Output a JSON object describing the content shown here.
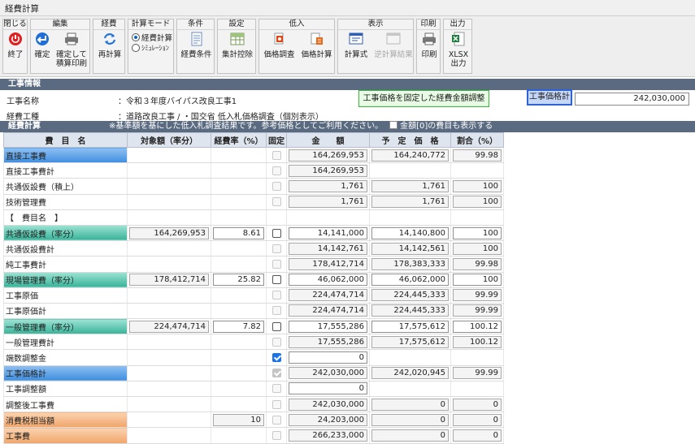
{
  "window": {
    "title": "経費計算"
  },
  "toolbar": {
    "close": {
      "title": "閉じる",
      "end": "終了"
    },
    "edit": {
      "title": "編集",
      "confirm": "確定",
      "confirm_print": "確定して積算印刷"
    },
    "cost": {
      "title": "経費",
      "recalc": "再計算"
    },
    "mode": {
      "title": "計算モード",
      "opt1": "経費計算",
      "opt2": "ｼﾐｭﾚｰｼｮﾝ"
    },
    "cond": {
      "title": "条件",
      "cond_btn": "経費条件"
    },
    "setting": {
      "title": "設定",
      "deduct": "集計控除"
    },
    "lowbid": {
      "title": "低入",
      "survey": "価格調査",
      "calc": "価格計算"
    },
    "display": {
      "title": "表示",
      "formula": "計算式",
      "reverse": "逆計算結果"
    },
    "print": {
      "title": "印刷",
      "print_btn": "印刷"
    },
    "output": {
      "title": "出力",
      "xlsx": "XLSX出力"
    }
  },
  "info": {
    "section": "工事情報",
    "name_label": "工事名称",
    "name_value": "：令和３年度バイパス改良工事1",
    "type_label": "経費工種",
    "type_value": "：道路改良工事 / ・国交省 低入札価格調査（個別表示）",
    "adjust_button": "工事価格を固定した経費金額調整",
    "price_label": "工事価格計",
    "price_value": "242,030,000"
  },
  "calc": {
    "section": "経費計算",
    "note": "※基準額を基にした低入札調査結果です。参考価格としてご利用ください。",
    "zero_check_label": "金額[0]の費目も表示する"
  },
  "table": {
    "headers": [
      "費　目　名",
      "対象額（率分）",
      "経費率（%）",
      "固定",
      "金　　額",
      "予　定　価　格",
      "割合（%）"
    ],
    "rows": [
      {
        "name": "直接工事費",
        "target": "",
        "rate": "",
        "amount": "164,269,953",
        "planned": "164,240,772",
        "ratio": "99.98"
      },
      {
        "name": "直接工事費計",
        "target": "",
        "rate": "",
        "amount": "164,269,953",
        "planned": "",
        "ratio": ""
      },
      {
        "name": "共通仮設費（積上）",
        "target": "",
        "rate": "",
        "amount": "1,761",
        "planned": "1,761",
        "ratio": "100"
      },
      {
        "name": "技術管理費",
        "target": "",
        "rate": "",
        "amount": "1,761",
        "planned": "1,761",
        "ratio": "100"
      },
      {
        "name": "【　費目名　】",
        "target": "",
        "rate": "",
        "amount": "",
        "planned": "",
        "ratio": ""
      },
      {
        "name": "共通仮設費（率分）",
        "target": "164,269,953",
        "rate": "8.61",
        "amount": "14,141,000",
        "planned": "14,140,800",
        "ratio": "100"
      },
      {
        "name": "共通仮設費計",
        "target": "",
        "rate": "",
        "amount": "14,142,761",
        "planned": "14,142,561",
        "ratio": "100"
      },
      {
        "name": "純工事費計",
        "target": "",
        "rate": "",
        "amount": "178,412,714",
        "planned": "178,383,333",
        "ratio": "99.98"
      },
      {
        "name": "現場管理費（率分）",
        "target": "178,412,714",
        "rate": "25.82",
        "amount": "46,062,000",
        "planned": "46,062,000",
        "ratio": "100"
      },
      {
        "name": "工事原価",
        "target": "",
        "rate": "",
        "amount": "224,474,714",
        "planned": "224,445,333",
        "ratio": "99.99"
      },
      {
        "name": "工事原価計",
        "target": "",
        "rate": "",
        "amount": "224,474,714",
        "planned": "224,445,333",
        "ratio": "99.99"
      },
      {
        "name": "一般管理費（率分）",
        "target": "224,474,714",
        "rate": "7.82",
        "amount": "17,555,286",
        "planned": "17,575,612",
        "ratio": "100.12"
      },
      {
        "name": "一般管理費計",
        "target": "",
        "rate": "",
        "amount": "17,555,286",
        "planned": "17,575,612",
        "ratio": "100.12"
      },
      {
        "name": "端数調整金",
        "target": "",
        "rate": "",
        "amount": "0",
        "planned": "",
        "ratio": ""
      },
      {
        "name": "工事価格計",
        "target": "",
        "rate": "",
        "amount": "242,030,000",
        "planned": "242,020,945",
        "ratio": "99.99"
      },
      {
        "name": "工事調整額",
        "target": "",
        "rate": "",
        "amount": "0",
        "planned": "",
        "ratio": ""
      },
      {
        "name": "調整後工事費",
        "target": "",
        "rate": "",
        "amount": "242,030,000",
        "planned": "0",
        "ratio": "0"
      },
      {
        "name": "消費税相当額",
        "target": "",
        "rate": "10",
        "amount": "24,203,000",
        "planned": "0",
        "ratio": "0"
      },
      {
        "name": "工事費",
        "target": "",
        "rate": "",
        "amount": "266,233,000",
        "planned": "0",
        "ratio": "0"
      }
    ]
  }
}
